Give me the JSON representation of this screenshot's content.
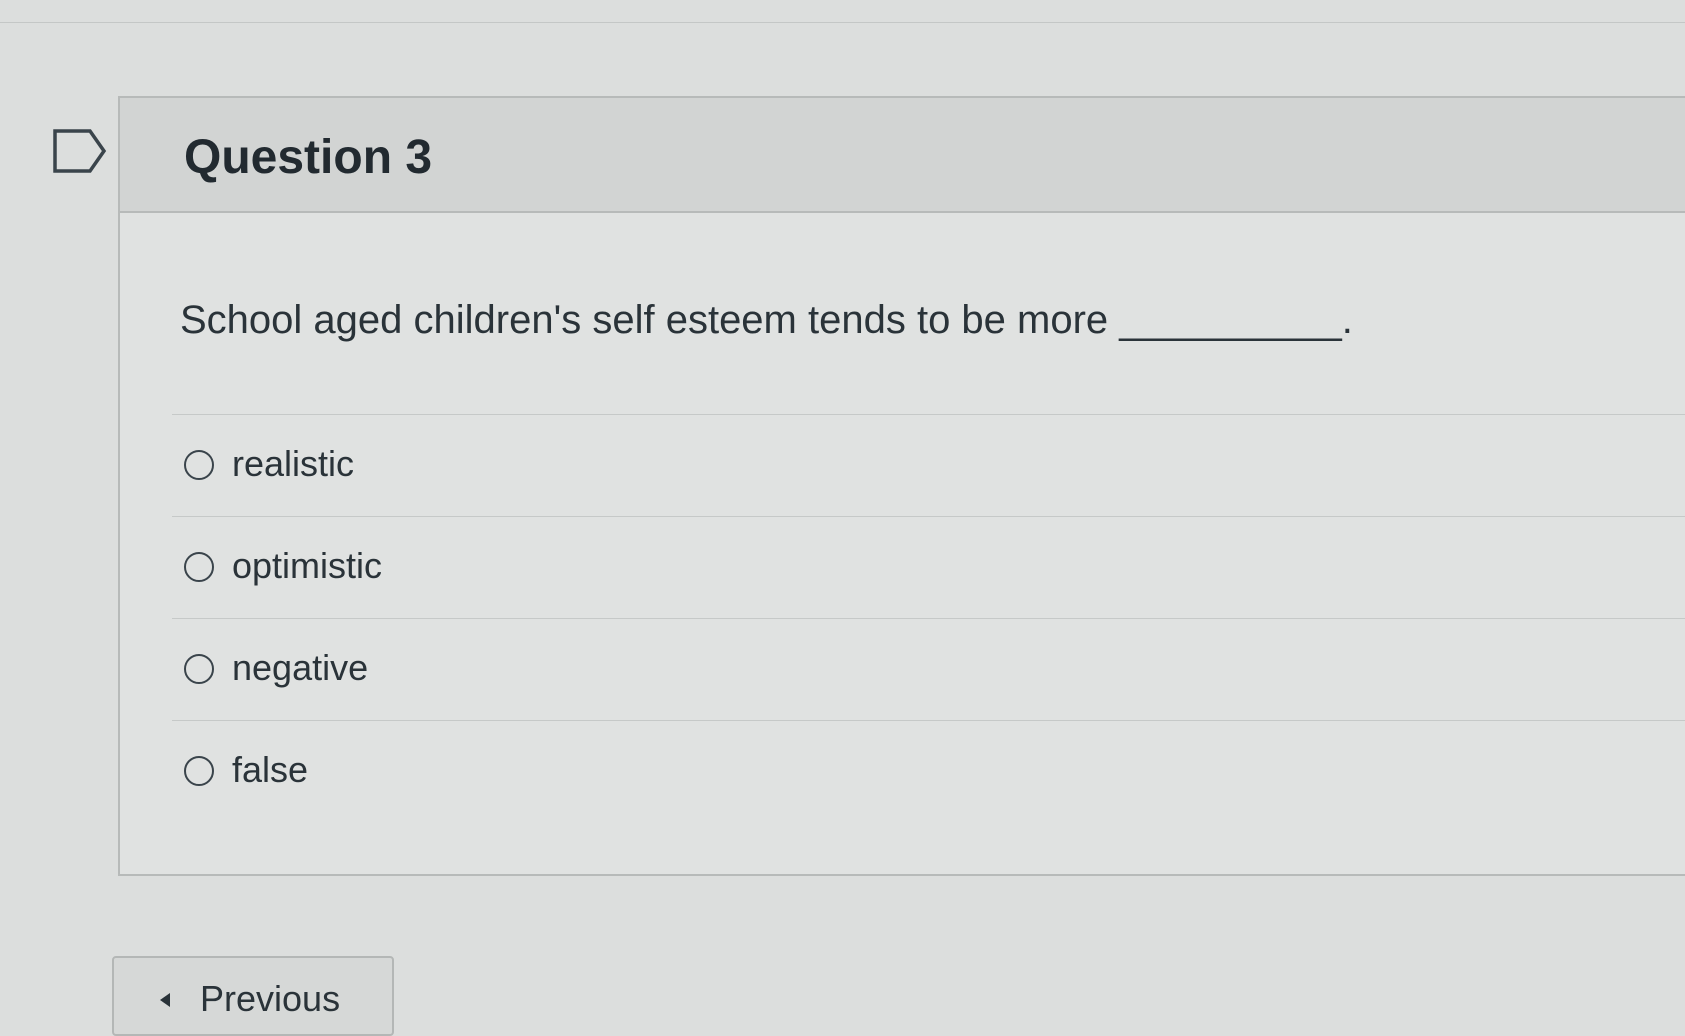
{
  "question": {
    "title": "Question 3",
    "text": "School aged children's self esteem tends to be more __________.",
    "answers": [
      {
        "label": "realistic",
        "selected": false
      },
      {
        "label": "optimistic",
        "selected": false
      },
      {
        "label": "negative",
        "selected": false
      },
      {
        "label": "false",
        "selected": false
      }
    ]
  },
  "navigation": {
    "previous_label": "Previous"
  },
  "icons": {
    "bookmark": "bookmark-flag-icon",
    "previous": "caret-left-icon"
  },
  "colors": {
    "header_bg": "#d2d4d3",
    "body_bg": "#e0e2e1",
    "text": "#2a3339"
  }
}
